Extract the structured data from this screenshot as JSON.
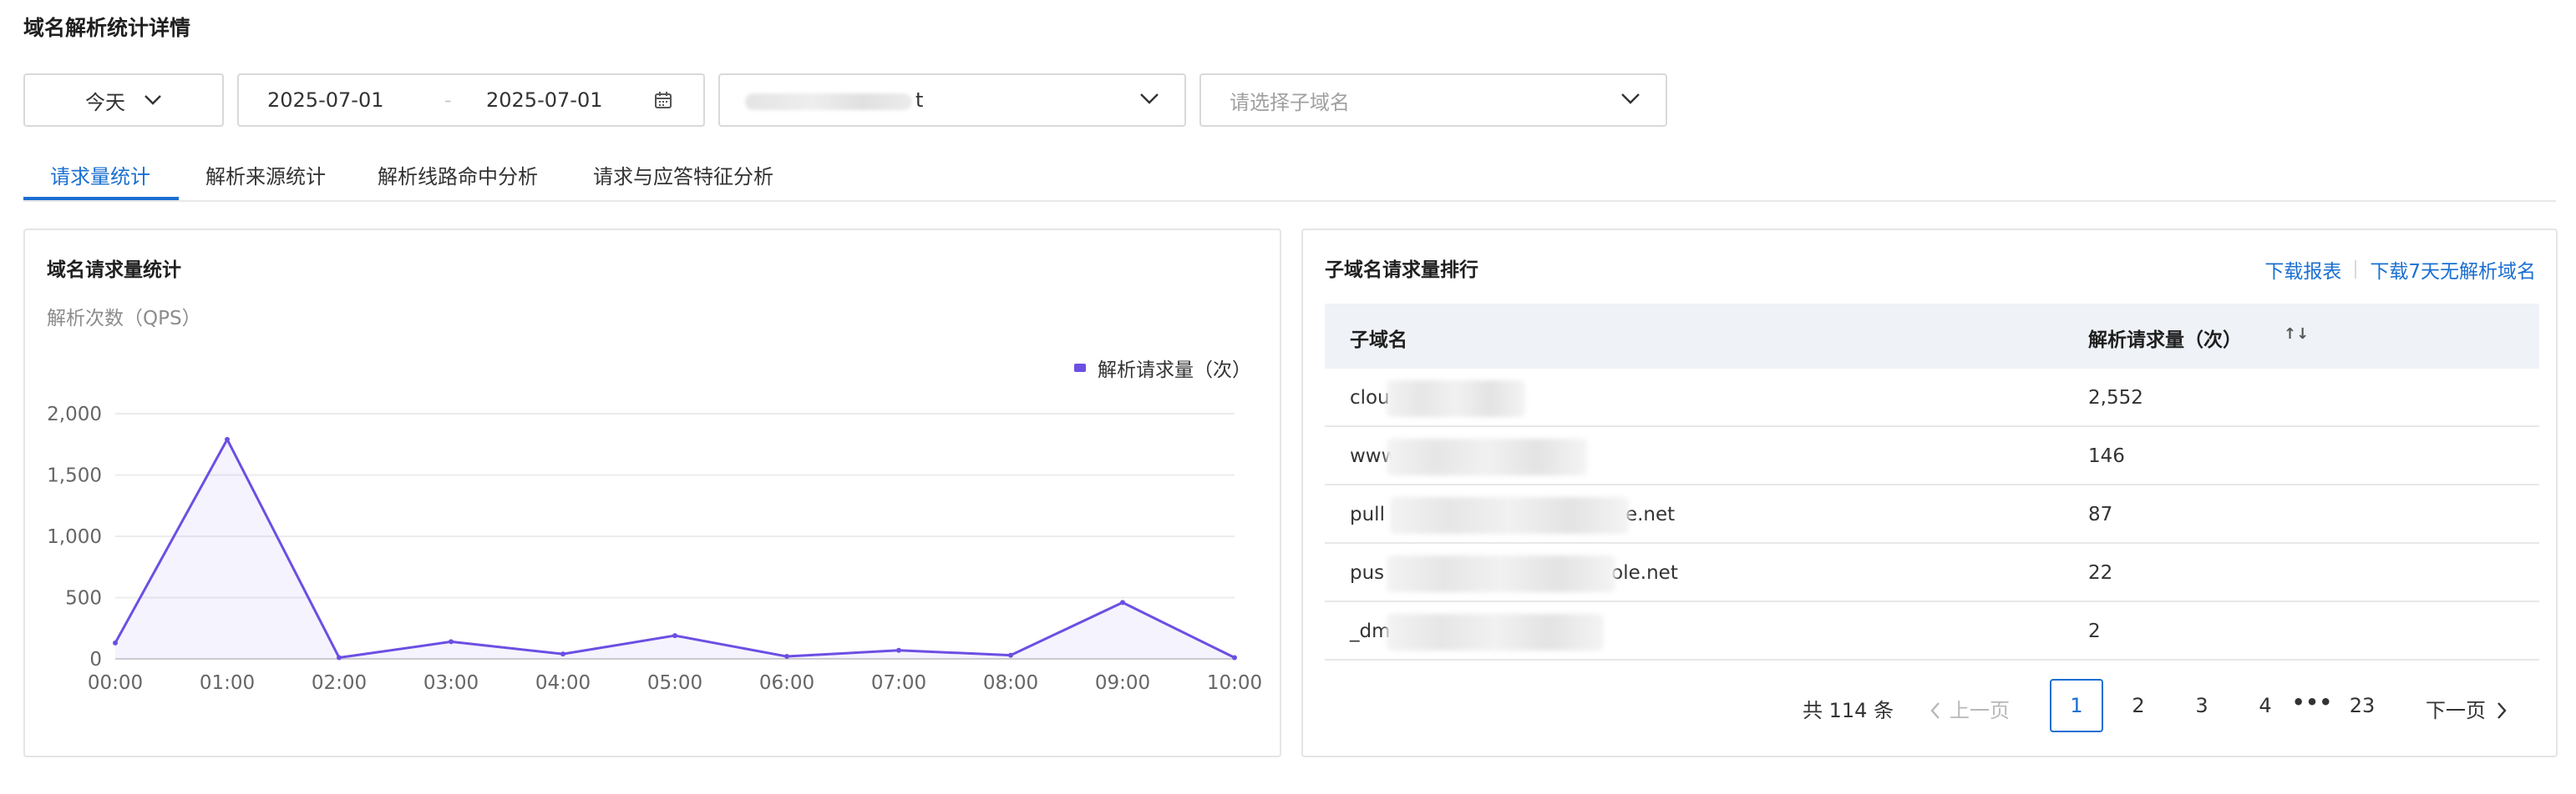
{
  "page": {
    "title": "域名解析统计详情"
  },
  "filters": {
    "period": "今天",
    "date_start": "2025-07-01",
    "date_sep": "-",
    "date_end": "2025-07-01",
    "domain_suffix": "t",
    "subdomain_placeholder": "请选择子域名"
  },
  "tabs": [
    {
      "label": "请求量统计",
      "active": true
    },
    {
      "label": "解析来源统计",
      "active": false
    },
    {
      "label": "解析线路命中分析",
      "active": false
    },
    {
      "label": "请求与应答特征分析",
      "active": false
    }
  ],
  "left_panel": {
    "title": "域名请求量统计"
  },
  "chart_data": {
    "type": "area",
    "title": "域名请求量统计",
    "ylabel": "解析次数（QPS）",
    "xlabel": "",
    "categories": [
      "00:00",
      "01:00",
      "02:00",
      "03:00",
      "04:00",
      "05:00",
      "06:00",
      "07:00",
      "08:00",
      "09:00",
      "10:00"
    ],
    "series": [
      {
        "name": "解析请求量（次）",
        "values": [
          130,
          1790,
          10,
          140,
          40,
          190,
          20,
          70,
          30,
          460,
          10
        ],
        "color": "#6c4fe3"
      }
    ],
    "ylim": [
      0,
      2000
    ],
    "yticks": [
      0,
      500,
      1000,
      1500,
      2000
    ],
    "ytick_labels": [
      "0",
      "500",
      "1,000",
      "1,500",
      "2,000"
    ],
    "grid": true,
    "legend": "top-right"
  },
  "right_panel": {
    "title": "子域名请求量排行",
    "link_download_report": "下载报表",
    "link_download_7days": "下载7天无解析域名",
    "columns": [
      "子域名",
      "解析请求量（次）"
    ],
    "sort_icon": "↑↓",
    "rows": [
      {
        "visible_prefix": "clou",
        "visible_suffix": "",
        "count": "2,552"
      },
      {
        "visible_prefix": "www",
        "visible_suffix": "",
        "count": "146"
      },
      {
        "visible_prefix": "pull",
        "visible_suffix": "e.net",
        "count": "87"
      },
      {
        "visible_prefix": "pus",
        "visible_suffix": "ole.net",
        "count": "22"
      },
      {
        "visible_prefix": "_dm",
        "visible_suffix": "",
        "count": "2"
      }
    ]
  },
  "pagination": {
    "total": "共 114 条",
    "prev": "上一页",
    "next": "下一页",
    "pages": [
      "1",
      "2",
      "3",
      "4",
      "23"
    ],
    "current": "1",
    "ellipsis": "•••"
  },
  "colors": {
    "accent": "#1a6fd1",
    "series": "#6c4fe3"
  }
}
